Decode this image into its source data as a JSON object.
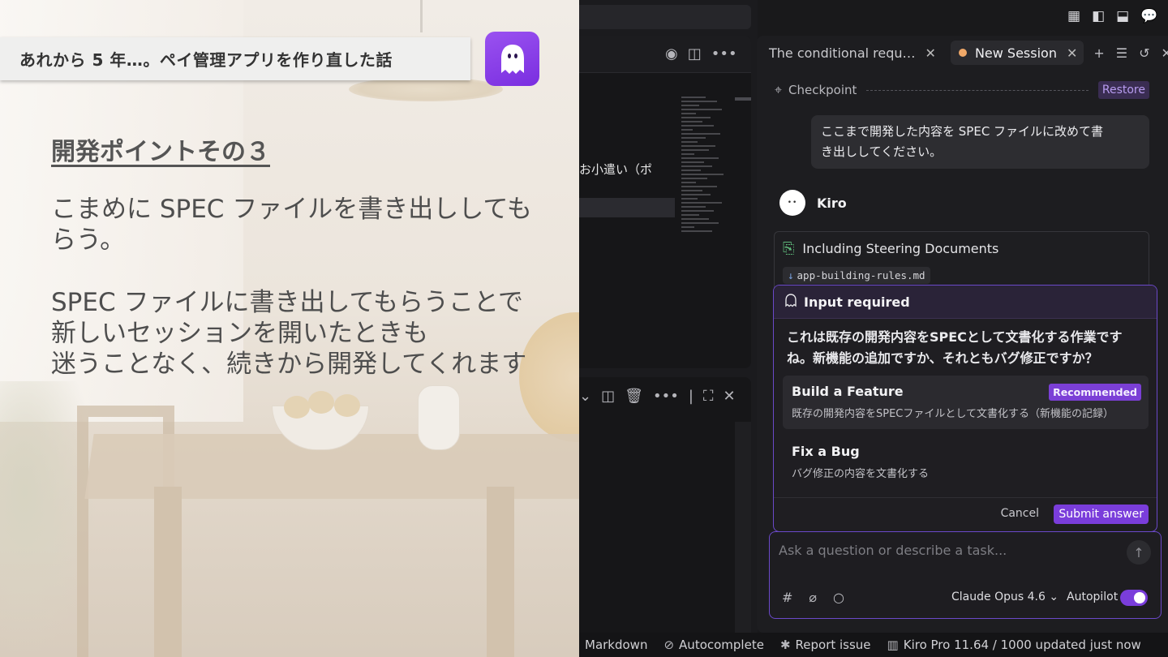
{
  "slide": {
    "title": "あれから 5 年…。ペイ管理アプリを作り直した話",
    "heading": "開発ポイントその３",
    "para1": [
      "こまめに SPEC ファイルを書き出ししても",
      "らう。"
    ],
    "para2": [
      "SPEC ファイルに書き出してもらうことで",
      "新しいセッションを開いたときも",
      "迷うことなく、続きから開発してくれます"
    ]
  },
  "editor": {
    "visible_text": "お小遣い（ポ"
  },
  "tabs": [
    {
      "label": "The conditional requ…",
      "active": false
    },
    {
      "label": "New Session",
      "active": true
    }
  ],
  "checkpoint": {
    "label": "Checkpoint",
    "restore_label": "Restore"
  },
  "user_message": [
    "ここまで開発した内容を SPEC ファイルに改めて書",
    "き出ししてください。"
  ],
  "assistant": {
    "name": "Kiro",
    "avatar_text": "••"
  },
  "steering": {
    "title": "Including Steering Documents",
    "file": "app-building-rules.md"
  },
  "input_required": {
    "title": "Input required",
    "question": [
      "これは既存の開発内容をSPECとして文書化する作業です",
      "ね。新機能の追加ですか、それともバグ修正ですか？"
    ],
    "options": [
      {
        "title": "Build a Feature",
        "desc": "既存の開発内容をSPECファイルとして文書化する（新機能の記録）",
        "badge": "Recommended"
      },
      {
        "title": "Fix a Bug",
        "desc": "バグ修正の内容を文書化する",
        "badge": ""
      }
    ],
    "cancel_label": "Cancel",
    "submit_label": "Submit answer"
  },
  "prompt": {
    "placeholder": "Ask a question or describe a task...",
    "model": "Claude Opus 4.6",
    "autopilot_label": "Autopilot",
    "autopilot_on": true
  },
  "statusbar": {
    "markdown": "Markdown",
    "autocomplete": "Autocomplete",
    "report": "Report issue",
    "plan": "Kiro Pro 11.64 / 1000 updated just now"
  },
  "colors": {
    "accent": "#7a3ddb",
    "slide_bg": "#ece5dc",
    "panel_bg": "#1d1d20"
  }
}
